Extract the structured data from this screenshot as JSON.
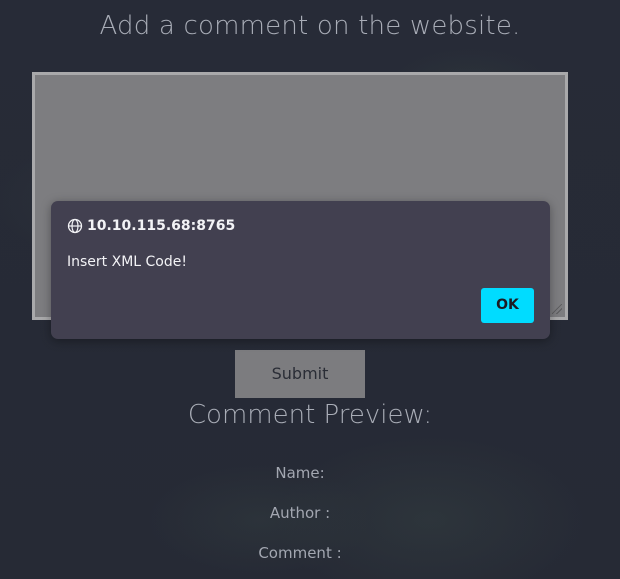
{
  "page": {
    "title": "Add a comment on the website.",
    "submit_label": "Submit",
    "preview_heading": "Comment Preview:",
    "preview_fields": {
      "name": "Name:",
      "author": "Author :",
      "comment": "Comment :"
    }
  },
  "alert": {
    "origin": "10.10.115.68:8765",
    "message": "Insert XML Code!",
    "ok_label": "OK"
  },
  "colors": {
    "background": "#262a36",
    "textarea": "#7d7d80",
    "alert_bg": "#424050",
    "ok_button": "#00dcff"
  },
  "icons": {
    "origin": "globe-icon"
  }
}
